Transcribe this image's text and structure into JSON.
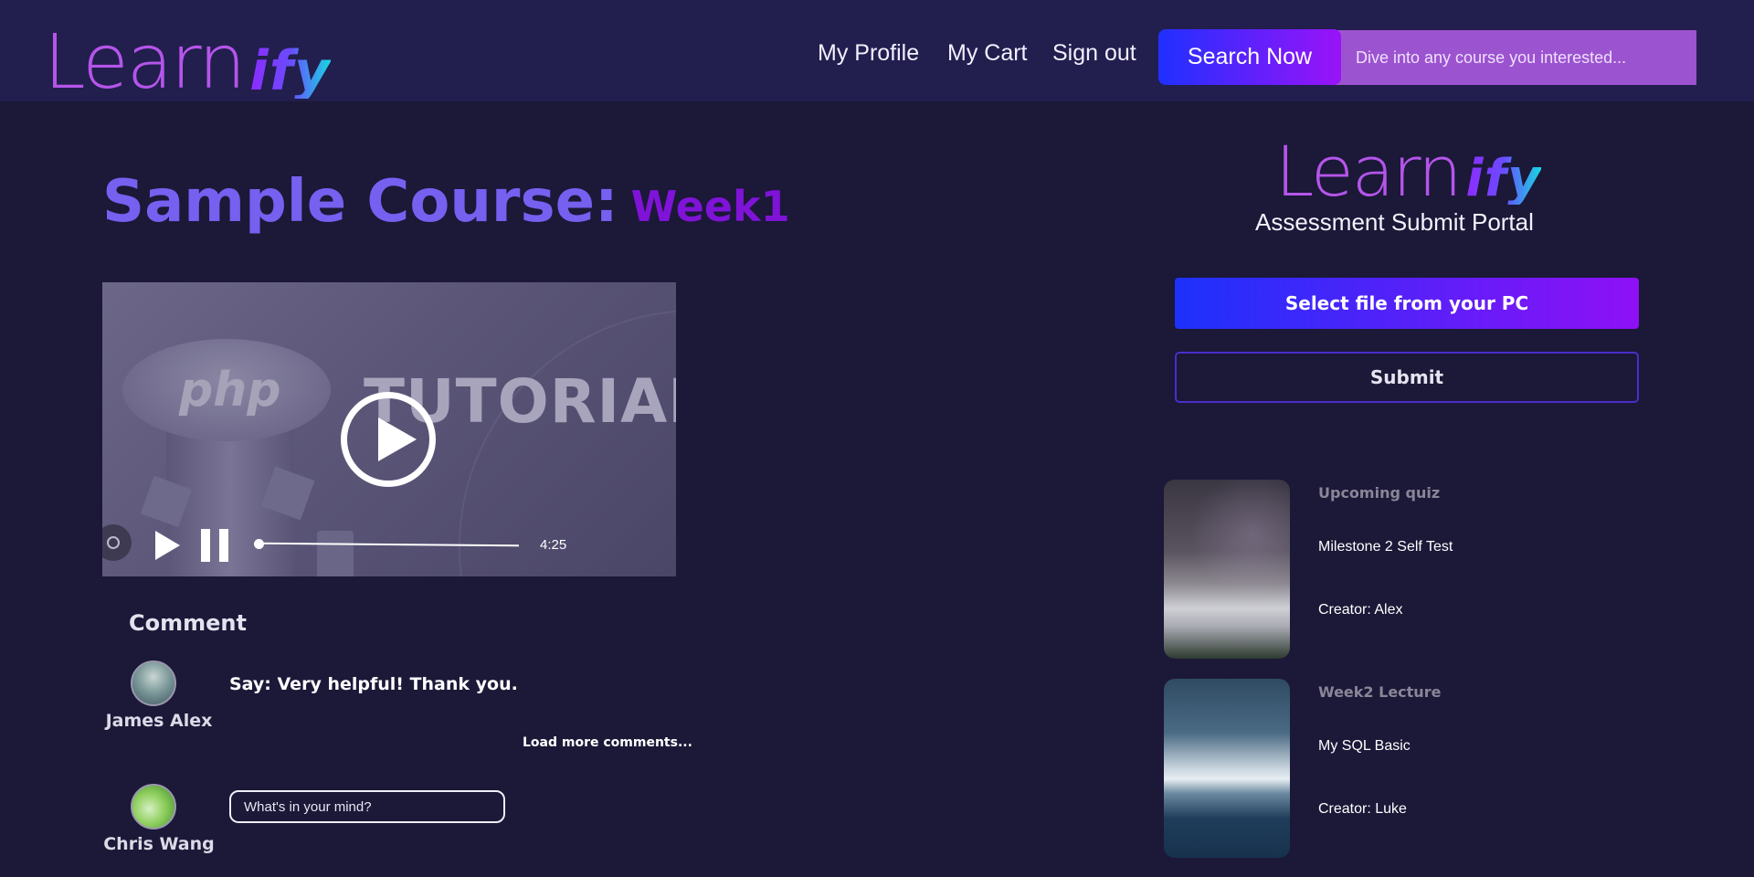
{
  "header": {
    "logo_learn": "Learn",
    "logo_ify": "ify",
    "nav": [
      "My Profile",
      "My Cart",
      "Sign out"
    ],
    "search_button": "Search Now",
    "search_placeholder": "Dive into any course you interested..."
  },
  "course": {
    "title": "Sample Course:",
    "week": "Week1"
  },
  "video": {
    "thumbnail_text_1": "php",
    "thumbnail_text_2": "TUTORIAL",
    "duration": "4:25",
    "progress_fraction": 0.0,
    "icons": [
      "play-circle-icon",
      "capture-icon",
      "play-icon",
      "pause-icon"
    ]
  },
  "comments": {
    "heading": "Comment",
    "items": [
      {
        "user": "James Alex",
        "text": "Say: Very helpful! Thank you."
      }
    ],
    "load_more": "Load more comments...",
    "current_user": "Chris Wang",
    "input_placeholder": "What's in your mind?"
  },
  "panel": {
    "logo_learn": "Learn",
    "logo_ify": "ify",
    "subtitle": "Assessment Submit Portal",
    "select_file": "Select file from your PC",
    "submit": "Submit",
    "cards": [
      {
        "label": "Upcoming quiz",
        "title": "Milestone 2 Self Test",
        "creator": "Creator: Alex"
      },
      {
        "label": "Week2 Lecture",
        "title": "My SQL Basic",
        "creator": "Creator: Luke"
      }
    ]
  },
  "colors": {
    "background": "#1b1838",
    "header_bg": "#221e4e",
    "accent_purple": "#7560f0",
    "week_purple": "#7f13d7",
    "gradient_blue": "#1d31fb",
    "gradient_violet": "#8f10f6"
  }
}
